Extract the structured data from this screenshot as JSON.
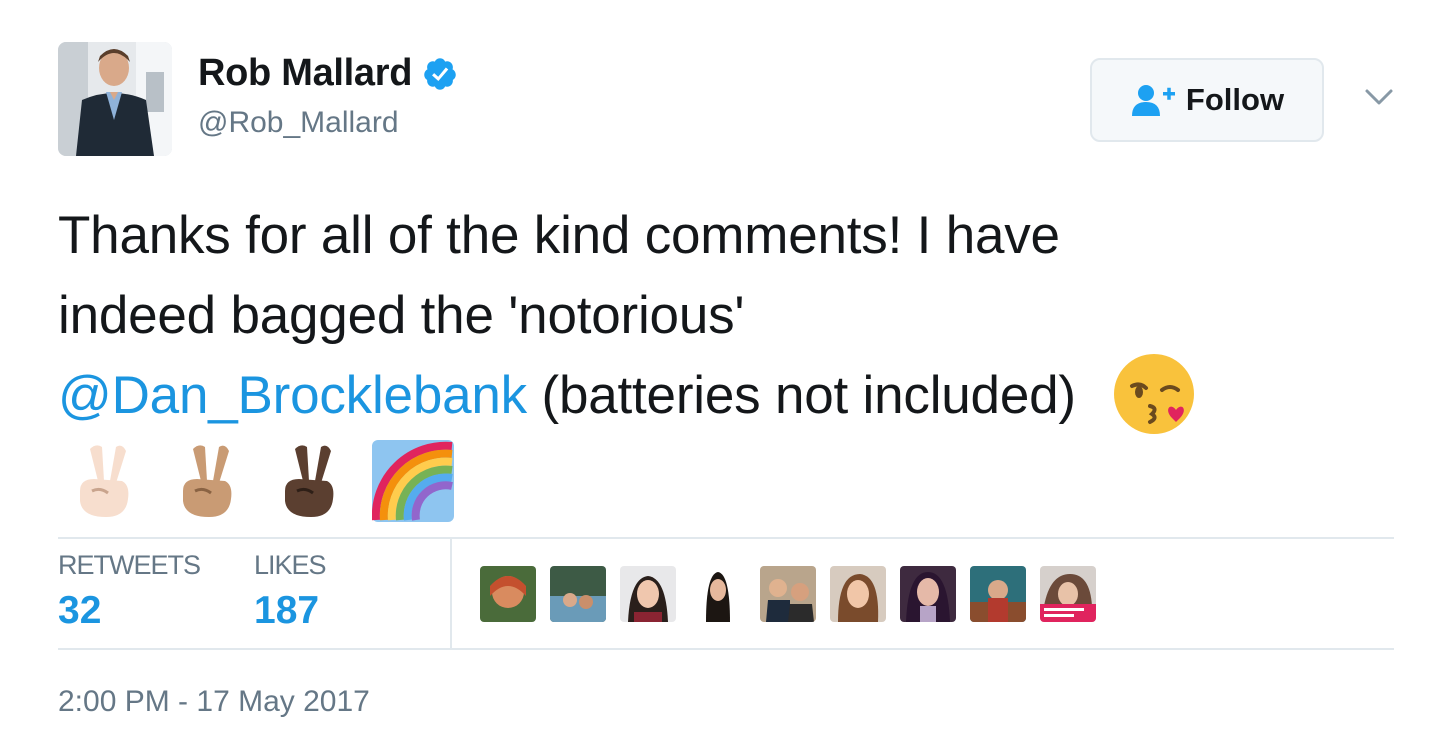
{
  "author": {
    "display_name": "Rob Mallard",
    "handle": "@Rob_Mallard",
    "verified": true
  },
  "follow_button": {
    "label": "Follow"
  },
  "tweet": {
    "line1": "Thanks for all of the kind comments! I have",
    "line2": "indeed bagged the 'notorious'",
    "mention": "@Dan_Brocklebank",
    "line3_rest": " (batteries not included)",
    "emojis_inline": [
      "kissing-wink-face-emoji"
    ],
    "emojis_line4": [
      "victory-hand-light-skin-emoji",
      "victory-hand-medium-skin-emoji",
      "victory-hand-dark-skin-emoji",
      "rainbow-emoji"
    ]
  },
  "stats": {
    "retweets_label": "RETWEETS",
    "retweets_count": "32",
    "likes_label": "LIKES",
    "likes_count": "187"
  },
  "likers_count_shown": 9,
  "timestamp": "2:00 PM - 17 May 2017",
  "colors": {
    "link_blue": "#1b95e0",
    "verified_blue": "#1da1f2",
    "secondary_text": "#657786",
    "border": "#e1e8ed"
  }
}
